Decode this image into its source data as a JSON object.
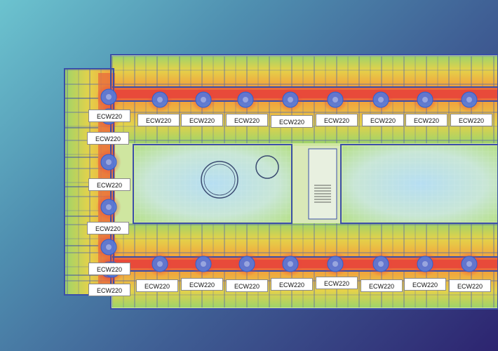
{
  "floor_plan": {
    "device_model": "ECW220",
    "colors": {
      "background_start": "#6cc3cf",
      "background_end": "#2d2470",
      "access_point": "#4a7ee8",
      "wall": "#3b4fa8",
      "signal_strong": "#e8453a",
      "signal_good": "#f0a030",
      "signal_medium": "#d8d848",
      "signal_fair": "#90d060",
      "signal_weak": "#a8dcf0"
    },
    "access_point_icon": "circle-icon",
    "top_row_labels": [
      "ECW220",
      "ECW220",
      "ECW220",
      "ECW220",
      "ECW220",
      "ECW220",
      "ECW220",
      "ECW220"
    ],
    "left_column_labels": [
      "ECW220",
      "ECW220",
      "ECW220",
      "ECW220",
      "ECW220",
      "ECW220"
    ],
    "bottom_row_labels": [
      "ECW220",
      "ECW220",
      "ECW220",
      "ECW220",
      "ECW220",
      "ECW220",
      "ECW220",
      "ECW220"
    ]
  }
}
